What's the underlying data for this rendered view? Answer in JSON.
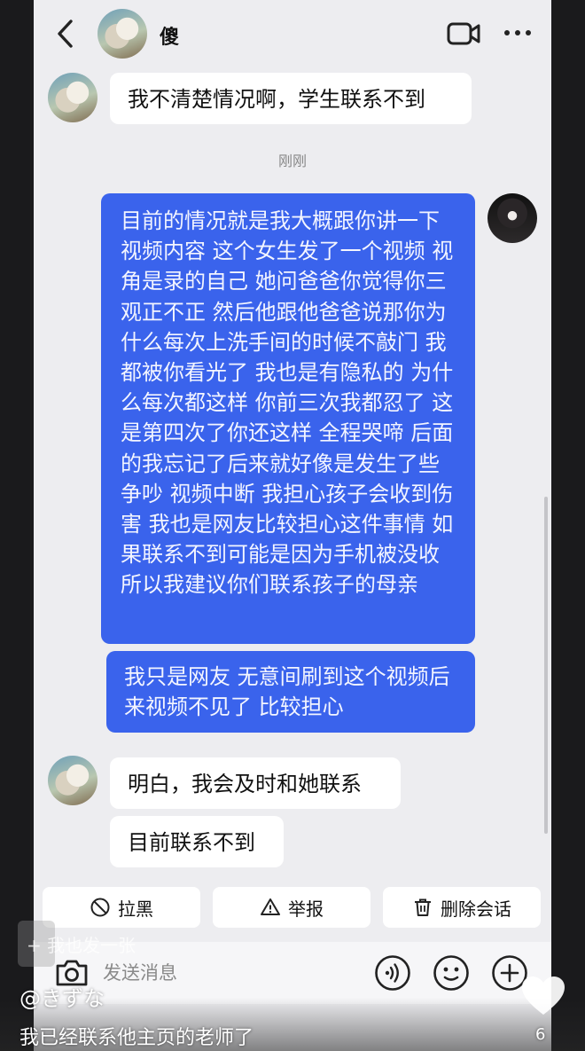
{
  "header": {
    "back_icon": "chevron-left-icon",
    "contact_name": "傻",
    "video_icon": "video-camera-icon",
    "more_icon": "more-dots-icon"
  },
  "messages": [
    {
      "side": "left",
      "text": "我不清楚情况啊，学生联系不到"
    },
    {
      "side": "right",
      "text": "目前的情况就是我大概跟你讲一下视频内容 这个女生发了一个视频 视角是录的自己 她问爸爸你觉得你三观正不正 然后他跟他爸爸说那你为什么每次上洗手间的时候不敲门 我都被你看光了 我也是有隐私的 为什么每次都这样 你前三次我都忍了 这是第四次了你还这样 全程哭啼 后面的我忘记了后来就好像是发生了些争吵 视频中断 我担心孩子会收到伤害 我也是网友比较担心这件事情 如果联系不到可能是因为手机被没收 所以我建议你们联系孩子的母亲"
    },
    {
      "side": "right",
      "text": "我只是网友 无意间刷到这个视频后来视频不见了 比较担心"
    },
    {
      "side": "left",
      "text": "明白，我会及时和她联系"
    },
    {
      "side": "left",
      "text": "目前联系不到"
    }
  ],
  "timestamp": "刚刚",
  "actions": {
    "block_label": "拉黑",
    "report_label": "举报",
    "delete_label": "删除会话"
  },
  "input": {
    "placeholder": "发送消息"
  },
  "overlay": {
    "share_tag": "+ 我也发一张",
    "watermark": "@きずな",
    "caption": "我已经联系他主页的老师了",
    "like_count": "6"
  },
  "colors": {
    "sent_bubble": "#3a63ec",
    "received_bubble": "#ffffff",
    "background": "#ededf0"
  }
}
